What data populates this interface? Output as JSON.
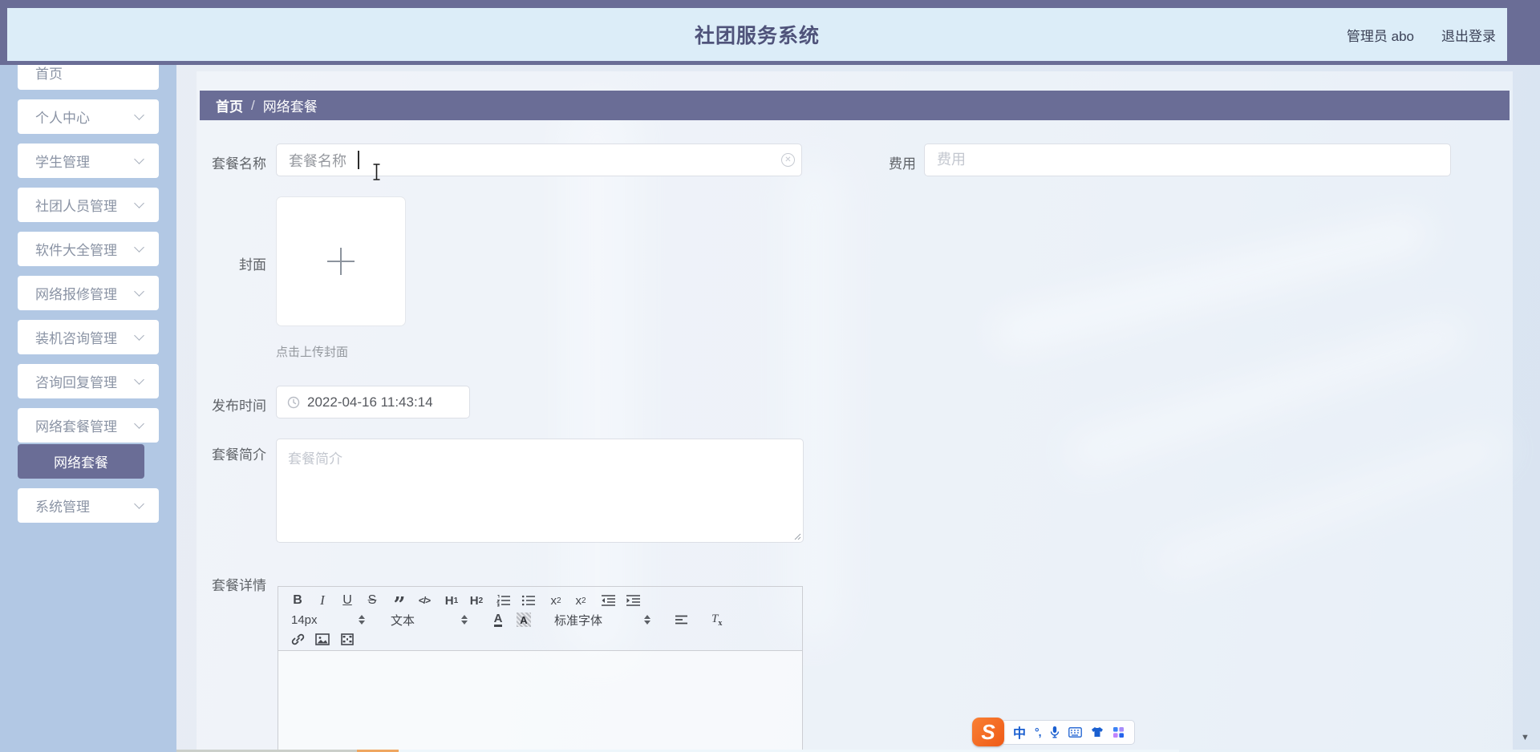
{
  "header": {
    "title": "社团服务系统",
    "user": "管理员 abo",
    "logout": "退出登录"
  },
  "sidebar": {
    "items": [
      {
        "label": "首页",
        "first": true,
        "no_chevron": true
      },
      {
        "label": "个人中心"
      },
      {
        "label": "学生管理"
      },
      {
        "label": "社团人员管理"
      },
      {
        "label": "软件大全管理"
      },
      {
        "label": "网络报修管理"
      },
      {
        "label": "装机咨询管理"
      },
      {
        "label": "咨询回复管理"
      },
      {
        "label": "网络套餐管理"
      },
      {
        "label": "网络套餐",
        "sub": true,
        "no_chevron": true,
        "active": true
      },
      {
        "label": "系统管理"
      }
    ]
  },
  "breadcrumb": {
    "home": "首页",
    "separator": "/",
    "current": "网络套餐"
  },
  "form": {
    "name": {
      "label": "套餐名称",
      "value": "套餐名称"
    },
    "fee": {
      "label": "费用",
      "placeholder": "费用"
    },
    "cover": {
      "label": "封面",
      "hint": "点击上传封面"
    },
    "time": {
      "label": "发布时间",
      "value": "2022-04-16 11:43:14"
    },
    "intro": {
      "label": "套餐简介",
      "placeholder": "套餐简介"
    },
    "detail": {
      "label": "套餐详情"
    }
  },
  "editor": {
    "bold": "B",
    "italic": "I",
    "underline": "U",
    "strike": "S",
    "quote": "”",
    "code": "</>",
    "h1": "H",
    "h1_s": "1",
    "h2": "H",
    "h2_s": "2",
    "sub": "x",
    "sub_s": "2",
    "sup": "x",
    "sup_s": "2",
    "size_value": "14px",
    "format_value": "文本",
    "font_value": "标准字体",
    "color_glyph": "A",
    "bg_glyph": "A",
    "clean": "T",
    "clean_s": "x"
  },
  "ime": {
    "logo": "S",
    "zh": "中",
    "punct": "°,"
  },
  "scroll_arrow": "▼",
  "colors": {
    "primary": "#6a6d96",
    "sidebar_bg": "#b2c8e4",
    "header_band": "#dcedf8",
    "accent_orange": "#f4701e",
    "link_blue": "#1a5fd0"
  }
}
